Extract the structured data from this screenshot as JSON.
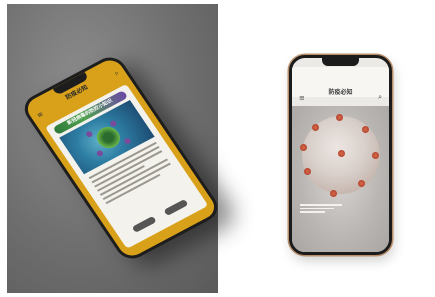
{
  "left_mockup": {
    "app_title": "防疫必知",
    "app_subtitle": "",
    "banner": "新冠病毒的防控小知识",
    "menu_icon": "hamburger-icon",
    "search_icon": "search-icon",
    "frame_color": "#d9a11a"
  },
  "right_mockup": {
    "app_title": "防疫必知",
    "app_subtitle": "",
    "menu_icon": "hamburger-icon",
    "search_icon": "search-icon",
    "frame_color": "#b88f6b"
  }
}
